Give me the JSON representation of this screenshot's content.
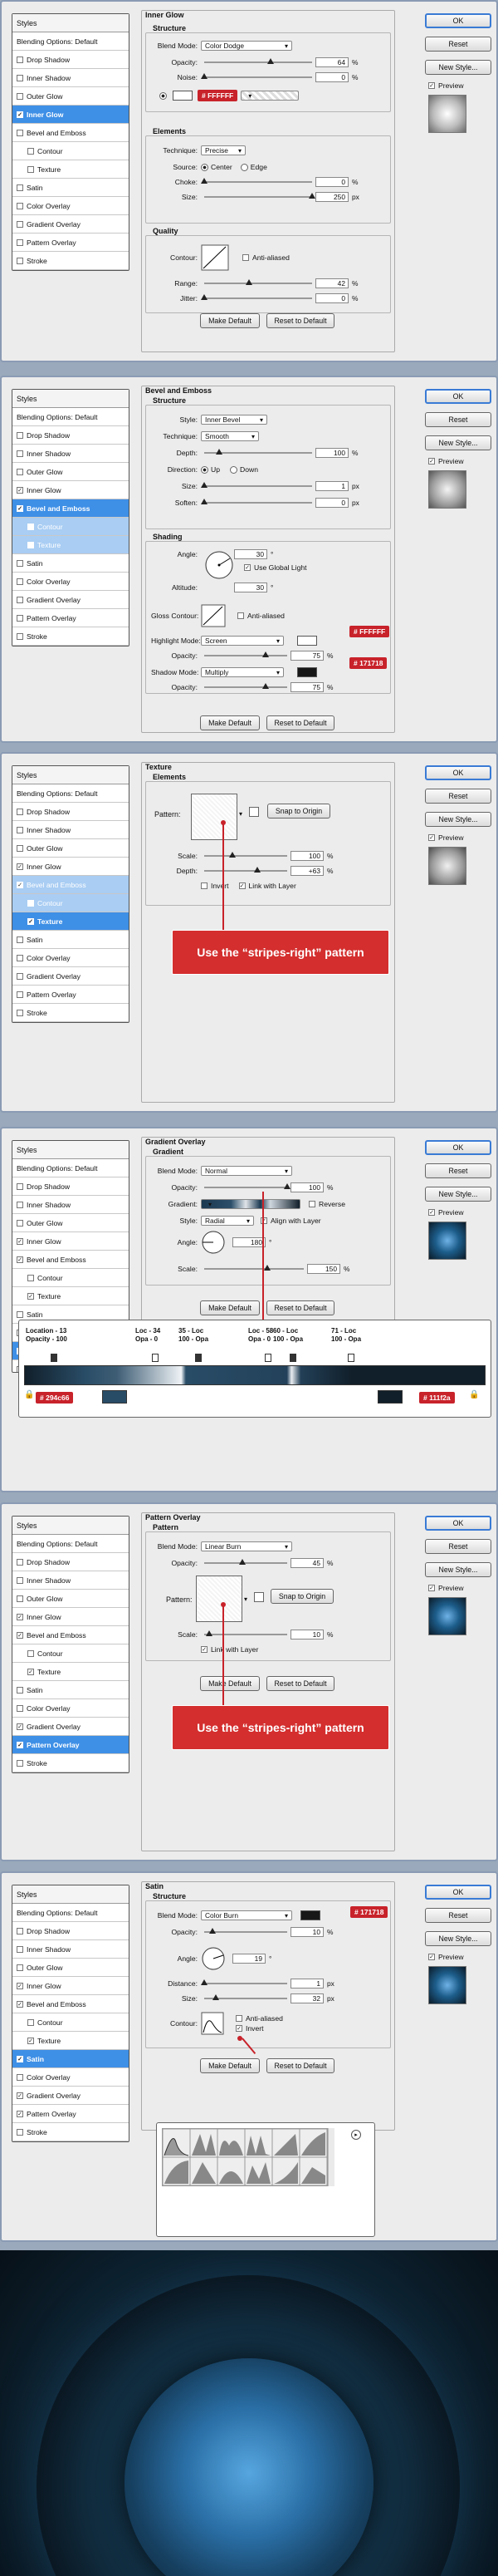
{
  "common": {
    "ok": "OK",
    "reset": "Reset",
    "new_style": "New Style...",
    "preview": "Preview",
    "styles": "Styles",
    "blending": "Blending Options: Default",
    "make_default": "Make Default",
    "reset_default": "Reset to Default"
  },
  "p1": {
    "section": "Inner Glow",
    "structure": "Structure",
    "blend_mode_label": "Blend Mode:",
    "blend_mode": "Color Dodge",
    "opacity_label": "Opacity:",
    "opacity": "64",
    "noise_label": "Noise:",
    "noise": "0",
    "color_badge": "# FFFFFF",
    "elements": "Elements",
    "technique_label": "Technique:",
    "technique": "Precise",
    "source_label": "Source:",
    "center": "Center",
    "edge": "Edge",
    "choke_label": "Choke:",
    "choke": "0",
    "size_label": "Size:",
    "size": "250",
    "quality": "Quality",
    "contour_label": "Contour:",
    "anti_aliased": "Anti-aliased",
    "range_label": "Range:",
    "range": "42",
    "jitter_label": "Jitter:",
    "jitter": "0",
    "pct": "%",
    "px": "px"
  },
  "p2": {
    "section": "Bevel and Emboss",
    "structure": "Structure",
    "style_label": "Style:",
    "style": "Inner Bevel",
    "technique_label": "Technique:",
    "technique": "Smooth",
    "depth_label": "Depth:",
    "depth": "100",
    "direction_label": "Direction:",
    "up": "Up",
    "down": "Down",
    "size_label": "Size:",
    "size": "1",
    "soften_label": "Soften:",
    "soften": "0",
    "shading": "Shading",
    "angle_label": "Angle:",
    "angle": "30",
    "use_global": "Use Global Light",
    "altitude_label": "Altitude:",
    "altitude": "30",
    "gloss_label": "Gloss Contour:",
    "anti_aliased": "Anti-aliased",
    "highlight_label": "Highlight Mode:",
    "highlight": "Screen",
    "highlight_badge": "# FFFFFF",
    "hl_opacity": "75",
    "shadow_label": "Shadow Mode:",
    "shadow": "Multiply",
    "shadow_badge": "# 171718",
    "sh_opacity": "75",
    "opacity_label": "Opacity:"
  },
  "p3": {
    "section": "Texture",
    "elements": "Elements",
    "pattern_label": "Pattern:",
    "snap": "Snap to Origin",
    "scale_label": "Scale:",
    "scale": "100",
    "depth_label": "Depth:",
    "depth": "+63",
    "invert": "Invert",
    "link": "Link with Layer",
    "callout": "Use the “stripes-right” pattern"
  },
  "p4": {
    "section": "Gradient Overlay",
    "gradient": "Gradient",
    "blend_mode_label": "Blend Mode:",
    "blend_mode": "Normal",
    "opacity_label": "Opacity:",
    "opacity": "100",
    "gradient_label": "Gradient:",
    "reverse": "Reverse",
    "style_label": "Style:",
    "style": "Radial",
    "align": "Align with Layer",
    "angle_label": "Angle:",
    "angle": "180",
    "scale_label": "Scale:",
    "scale": "150",
    "stops": [
      "Location - 13\nOpacity - 100",
      "Loc - 34\nOpa - 0",
      "35 - Loc\n100 - Opa",
      "Loc - 58\nOpa - 0",
      "60 - Loc\n100 - Opa",
      "71 - Loc\n100 - Opa"
    ],
    "badge_left": "# 294c66",
    "badge_right": "# 111f2a"
  },
  "p5": {
    "section": "Pattern Overlay",
    "pattern": "Pattern",
    "blend_mode_label": "Blend Mode:",
    "blend_mode": "Linear Burn",
    "opacity_label": "Opacity:",
    "opacity": "45",
    "pattern_label": "Pattern:",
    "snap": "Snap to Origin",
    "scale_label": "Scale:",
    "scale": "10",
    "link": "Link with Layer",
    "callout": "Use the “stripes-right” pattern"
  },
  "p6": {
    "section": "Satin",
    "structure": "Structure",
    "blend_mode_label": "Blend Mode:",
    "blend_mode": "Color Burn",
    "badge": "# 171718",
    "opacity_label": "Opacity:",
    "opacity": "10",
    "angle_label": "Angle:",
    "angle": "19",
    "distance_label": "Distance:",
    "distance": "1",
    "size_label": "Size:",
    "size": "32",
    "contour_label": "Contour:",
    "anti_aliased": "Anti-aliased",
    "invert": "Invert"
  },
  "style_lists": {
    "p1": [
      {
        "l": "Drop Shadow",
        "c": false
      },
      {
        "l": "Inner Shadow",
        "c": false
      },
      {
        "l": "Outer Glow",
        "c": false
      },
      {
        "l": "Inner Glow",
        "c": true,
        "s": 1
      },
      {
        "l": "Bevel and Emboss",
        "c": false
      },
      {
        "l": "Contour",
        "c": false,
        "sub": 1
      },
      {
        "l": "Texture",
        "c": false,
        "sub": 1
      },
      {
        "l": "Satin",
        "c": false
      },
      {
        "l": "Color Overlay",
        "c": false
      },
      {
        "l": "Gradient Overlay",
        "c": false
      },
      {
        "l": "Pattern Overlay",
        "c": false
      },
      {
        "l": "Stroke",
        "c": false
      }
    ],
    "p2": [
      {
        "l": "Drop Shadow",
        "c": false
      },
      {
        "l": "Inner Shadow",
        "c": false
      },
      {
        "l": "Outer Glow",
        "c": false
      },
      {
        "l": "Inner Glow",
        "c": true
      },
      {
        "l": "Bevel and Emboss",
        "c": true,
        "s": 1
      },
      {
        "l": "Contour",
        "c": false,
        "sub": 1,
        "s": 2
      },
      {
        "l": "Texture",
        "c": false,
        "sub": 1,
        "s": 2
      },
      {
        "l": "Satin",
        "c": false
      },
      {
        "l": "Color Overlay",
        "c": false
      },
      {
        "l": "Gradient Overlay",
        "c": false
      },
      {
        "l": "Pattern Overlay",
        "c": false
      },
      {
        "l": "Stroke",
        "c": false
      }
    ],
    "p3": [
      {
        "l": "Drop Shadow",
        "c": false
      },
      {
        "l": "Inner Shadow",
        "c": false
      },
      {
        "l": "Outer Glow",
        "c": false
      },
      {
        "l": "Inner Glow",
        "c": true
      },
      {
        "l": "Bevel and Emboss",
        "c": true,
        "s": 2
      },
      {
        "l": "Contour",
        "c": false,
        "sub": 1,
        "s": 2
      },
      {
        "l": "Texture",
        "c": true,
        "sub": 1,
        "s": 1
      },
      {
        "l": "Satin",
        "c": false
      },
      {
        "l": "Color Overlay",
        "c": false
      },
      {
        "l": "Gradient Overlay",
        "c": false
      },
      {
        "l": "Pattern Overlay",
        "c": false
      },
      {
        "l": "Stroke",
        "c": false
      }
    ],
    "p4": [
      {
        "l": "Drop Shadow",
        "c": false
      },
      {
        "l": "Inner Shadow",
        "c": false
      },
      {
        "l": "Outer Glow",
        "c": false
      },
      {
        "l": "Inner Glow",
        "c": true
      },
      {
        "l": "Bevel and Emboss",
        "c": true
      },
      {
        "l": "Contour",
        "c": false,
        "sub": 1
      },
      {
        "l": "Texture",
        "c": true,
        "sub": 1
      },
      {
        "l": "Satin",
        "c": false
      },
      {
        "l": "Color Overlay",
        "c": false
      },
      {
        "l": "Gradient Overlay",
        "c": true,
        "s": 1
      },
      {
        "l": "Pattern Overlay",
        "c": false
      }
    ],
    "p5": [
      {
        "l": "Drop Shadow",
        "c": false
      },
      {
        "l": "Inner Shadow",
        "c": false
      },
      {
        "l": "Outer Glow",
        "c": false
      },
      {
        "l": "Inner Glow",
        "c": true
      },
      {
        "l": "Bevel and Emboss",
        "c": true
      },
      {
        "l": "Contour",
        "c": false,
        "sub": 1
      },
      {
        "l": "Texture",
        "c": true,
        "sub": 1
      },
      {
        "l": "Satin",
        "c": false
      },
      {
        "l": "Color Overlay",
        "c": false
      },
      {
        "l": "Gradient Overlay",
        "c": true
      },
      {
        "l": "Pattern Overlay",
        "c": true,
        "s": 1
      },
      {
        "l": "Stroke",
        "c": false
      }
    ],
    "p6": [
      {
        "l": "Drop Shadow",
        "c": false
      },
      {
        "l": "Inner Shadow",
        "c": false
      },
      {
        "l": "Outer Glow",
        "c": false
      },
      {
        "l": "Inner Glow",
        "c": true
      },
      {
        "l": "Bevel and Emboss",
        "c": true
      },
      {
        "l": "Contour",
        "c": false,
        "sub": 1
      },
      {
        "l": "Texture",
        "c": true,
        "sub": 1
      },
      {
        "l": "Satin",
        "c": true,
        "s": 1
      },
      {
        "l": "Color Overlay",
        "c": false
      },
      {
        "l": "Gradient Overlay",
        "c": true
      },
      {
        "l": "Pattern Overlay",
        "c": true
      },
      {
        "l": "Stroke",
        "c": false
      }
    ]
  },
  "colors": {
    "accent": "#3e8fe6",
    "badge": "#c8222a",
    "glow": "#1d5e8c",
    "dark": "#0b1b28"
  }
}
